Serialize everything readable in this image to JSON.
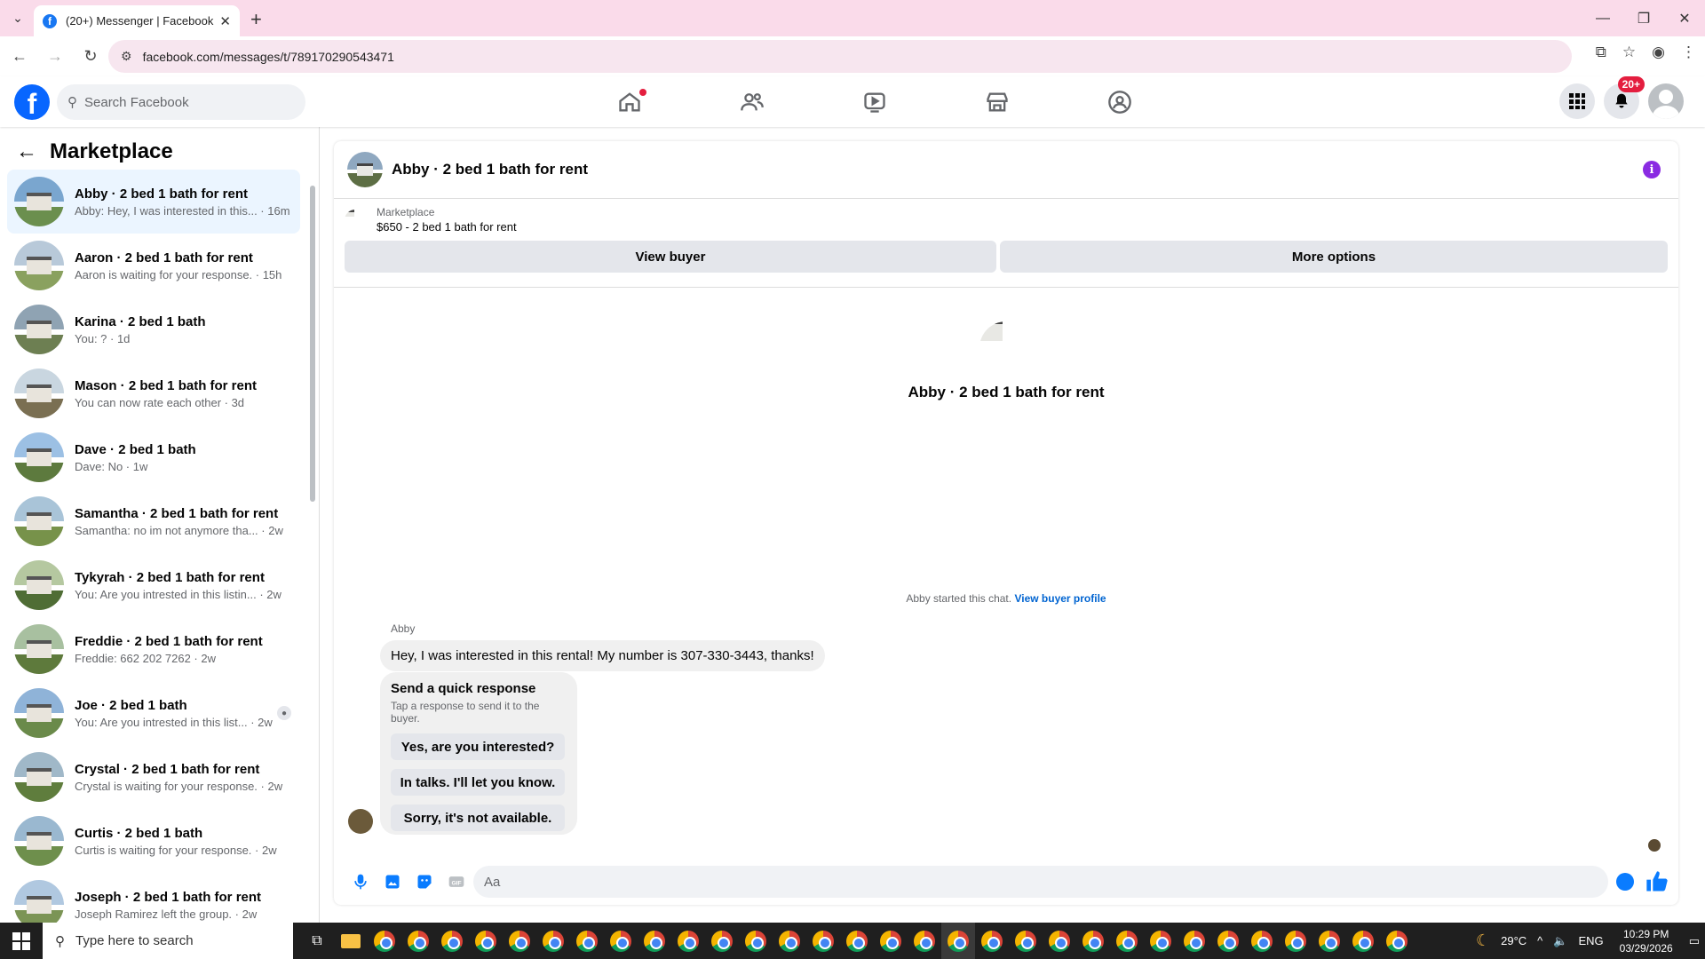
{
  "browser": {
    "tab_title": "(20+) Messenger | Facebook",
    "url": "facebook.com/messages/t/789170290543471"
  },
  "facebook": {
    "search_placeholder": "Search Facebook",
    "notifications_badge": "20+"
  },
  "sidebar": {
    "title": "Marketplace",
    "conversations": [
      {
        "name": "Abby · 2 bed 1 bath for rent",
        "snippet": "Abby: Hey, I was interested in this... · 16m",
        "active": true
      },
      {
        "name": "Aaron · 2 bed 1 bath for rent",
        "snippet": "Aaron is waiting for your response. · 15h"
      },
      {
        "name": "Karina · 2 bed 1 bath",
        "snippet": "You: ? · 1d"
      },
      {
        "name": "Mason · 2 bed 1 bath for rent",
        "snippet": "You can now rate each other · 3d"
      },
      {
        "name": "Dave · 2 bed 1 bath",
        "snippet": "Dave: No · 1w"
      },
      {
        "name": "Samantha · 2 bed 1 bath for rent",
        "snippet": "Samantha: no im not anymore tha... · 2w"
      },
      {
        "name": "Tykyrah · 2 bed 1 bath for rent",
        "snippet": "You: Are you intrested in this listin... · 2w"
      },
      {
        "name": "Freddie · 2 bed 1 bath for rent",
        "snippet": "Freddie: 662 202 7262 · 2w"
      },
      {
        "name": "Joe · 2 bed 1 bath",
        "snippet": "You: Are you intrested in this list... · 2w"
      },
      {
        "name": "Crystal · 2 bed 1 bath for rent",
        "snippet": "Crystal is waiting for your response. · 2w"
      },
      {
        "name": "Curtis · 2 bed 1 bath",
        "snippet": "Curtis is waiting for your response. · 2w"
      },
      {
        "name": "Joseph · 2 bed 1 bath for rent",
        "snippet": "Joseph Ramirez left the group. · 2w"
      }
    ]
  },
  "chat": {
    "title": "Abby · 2 bed 1 bath for rent",
    "listing_label": "Marketplace",
    "listing_price": "$650 - 2 bed 1 bath for rent",
    "view_buyer": "View buyer",
    "more_options": "More options",
    "profile_name": "Abby · 2 bed 1 bath for rent",
    "started_text": "Abby started this chat.",
    "view_buyer_profile": "View buyer profile",
    "sender": "Abby",
    "message": "Hey, I was interested in this rental! My number is 307-330-3443, thanks!",
    "quick_response_title": "Send a quick response",
    "quick_response_subtitle": "Tap a response to send it to the buyer.",
    "quick_responses": [
      "Yes, are you interested?",
      "In talks. I'll let you know.",
      "Sorry, it's not available."
    ],
    "composer_placeholder": "Aa"
  },
  "taskbar": {
    "search_placeholder": "Type here to search",
    "weather": "29°C",
    "language": "ENG",
    "time": "10:29 PM",
    "date": "03/29/2026"
  },
  "colors": {
    "accent": "#0866ff",
    "chrome_frame": "#fadbea",
    "active_conv": "#ebf5ff"
  }
}
